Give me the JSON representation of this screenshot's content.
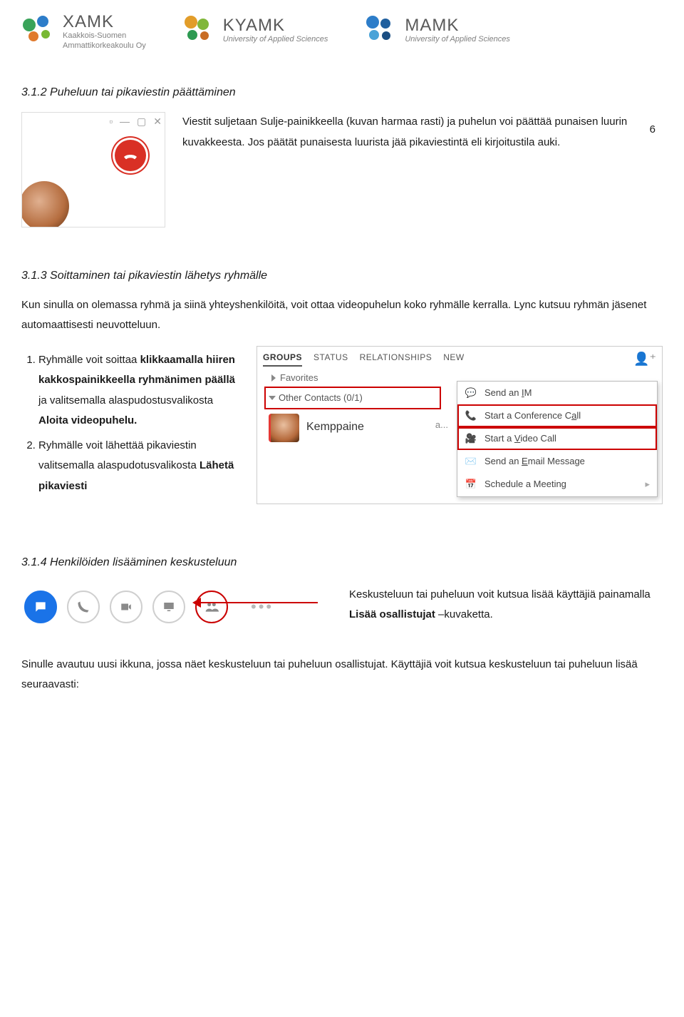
{
  "page_number": "6",
  "header": {
    "logos": [
      {
        "name": "XAMK",
        "subtitle1": "Kaakkois-Suomen",
        "subtitle2": "Ammattikorkeakoulu Oy"
      },
      {
        "name": "KYAMK",
        "subtitle1": "University of Applied Sciences"
      },
      {
        "name": "MAMK",
        "subtitle1": "University of Applied Sciences"
      }
    ]
  },
  "sections": {
    "s312": {
      "title": "3.1.2 Puheluun tai pikaviestin päättäminen",
      "para": "Viestit suljetaan Sulje-painikkeella (kuvan harmaa rasti) ja puhelun voi päättää punaisen luurin kuvakkeesta. Jos päätät punaisesta luurista jää pikaviestintä eli kirjoitustila auki."
    },
    "s313": {
      "title": "3.1.3 Soittaminen tai pikaviestin lähetys ryhmälle",
      "intro": "Kun sinulla on olemassa ryhmä ja siinä yhteyshenkilöitä, voit ottaa videopuhelun koko ryhmälle kerralla. Lync kutsuu ryhmän jäsenet automaattisesti neuvotteluun.",
      "li1_pre": "Ryhmälle voit soittaa ",
      "li1_b1": "klikkaamalla hiiren kakkospainikkeella ryhmänimen päällä",
      "li1_mid": " ja valitsemalla alaspudostusvalikosta ",
      "li1_b2": "Aloita videopuhelu.",
      "li2_pre": "Ryhmälle voit lähettää pikaviestin valitsemalla alaspudotusvalikosta ",
      "li2_b": "Lähetä pikaviesti",
      "tabs": {
        "groups": "GROUPS",
        "status": "STATUS",
        "rel": "RELATIONSHIPS",
        "new": "NEW"
      },
      "fav": "Favorites",
      "other": "Other Contacts (0/1)",
      "kemp": "Kemppaine",
      "kemp_tail": "a...",
      "menu": {
        "im_pre": "Send an ",
        "im_u": "I",
        "im_post": "M",
        "conf_pre": "Start a Conference C",
        "conf_u": "a",
        "conf_post": "ll",
        "vid_pre": "Start a ",
        "vid_u": "V",
        "vid_post": "ideo Call",
        "em_pre": "Send an ",
        "em_u": "E",
        "em_post": "mail Message",
        "sched": "Schedule a Meeting"
      }
    },
    "s314": {
      "title": "3.1.4 Henkilöiden lisääminen keskusteluun",
      "para_pre": "Keskusteluun tai puheluun voit kutsua lisää käyttäjiä painamalla ",
      "para_b": "Lisää osallistujat",
      "para_post": " –kuvaketta."
    },
    "final": "Sinulle avautuu uusi ikkuna, jossa näet keskusteluun tai puheluun osallistujat. Käyttäjiä voit kutsua keskusteluun tai puheluun lisää seuraavasti:"
  },
  "icons": {
    "hangup": "hangup-icon",
    "close_x": "×",
    "cam": "video-icon"
  }
}
